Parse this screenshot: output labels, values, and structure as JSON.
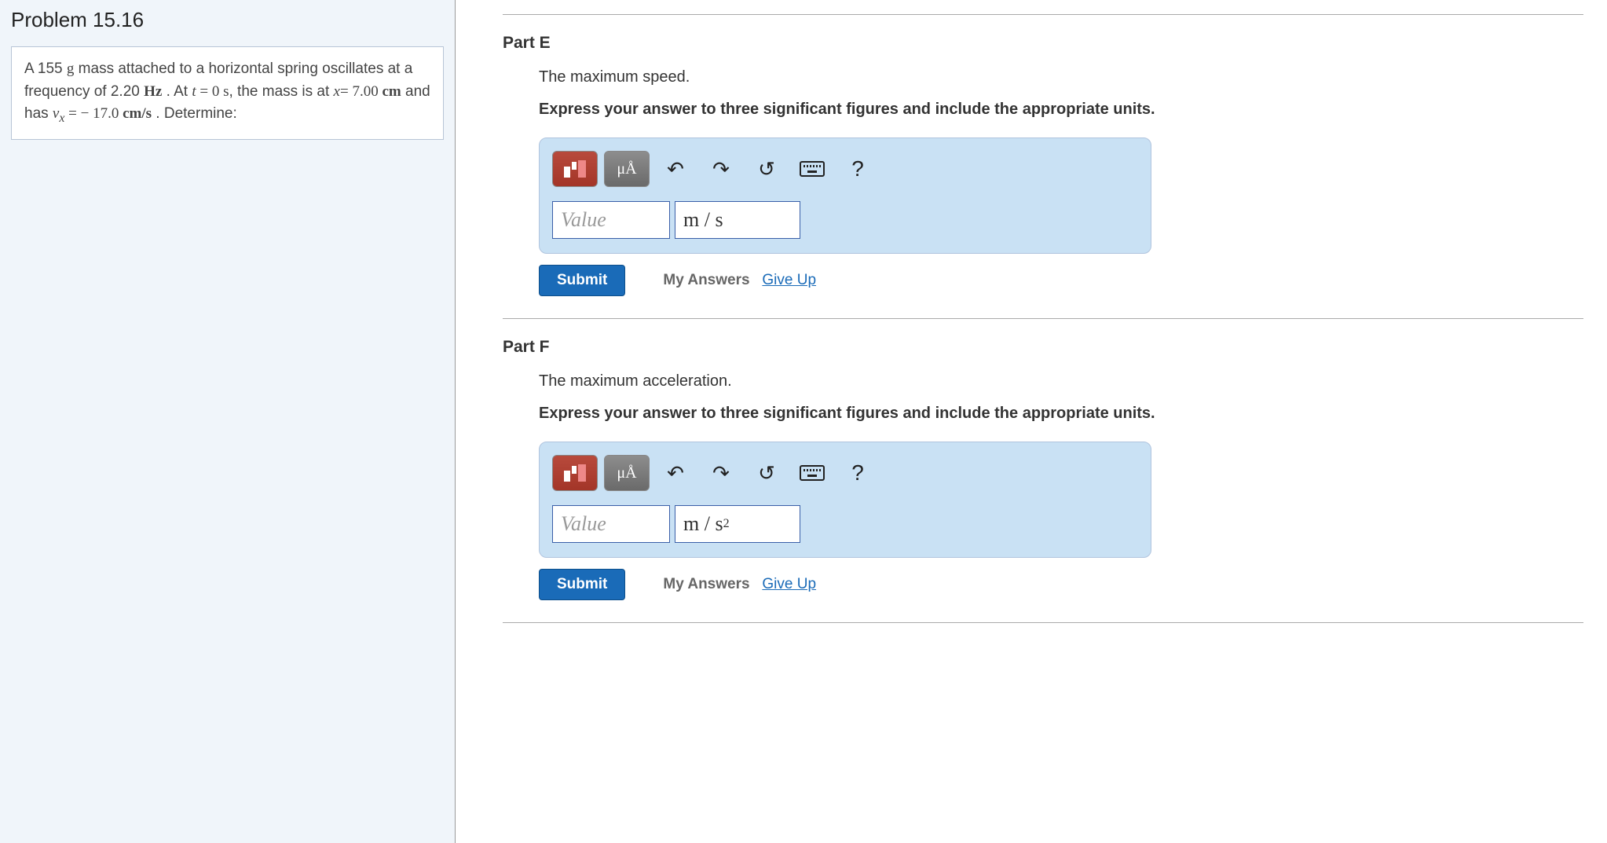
{
  "problem": {
    "title": "Problem 15.16",
    "description_html": "A 155 <span class='math'>g</span> mass attached to a horizontal spring oscillates at a frequency of 2.20 <span class='math'><b>Hz</b></span> . At <span class='math'><i>t</i> = 0 s</span>, the mass is at <span class='math'><i>x</i>= 7.00 <b>cm</b></span> and has <span class='math'><i>v<sub>x</sub></i> = − 17.0 <b>cm/s</b></span> . Determine:"
  },
  "toolbar": {
    "greek_label": "μÅ",
    "help_label": "?"
  },
  "parts": [
    {
      "id": "E",
      "title": "Part E",
      "prompt": "The maximum speed.",
      "instruction": "Express your answer to three significant figures and include the appropriate units.",
      "value_placeholder": "Value",
      "units_display": "m / s"
    },
    {
      "id": "F",
      "title": "Part F",
      "prompt": "The maximum acceleration.",
      "instruction": "Express your answer to three significant figures and include the appropriate units.",
      "value_placeholder": "Value",
      "units_display": "m / s<sup>2</sup>"
    }
  ],
  "actions": {
    "submit": "Submit",
    "my_answers": "My Answers",
    "give_up": "Give Up"
  }
}
